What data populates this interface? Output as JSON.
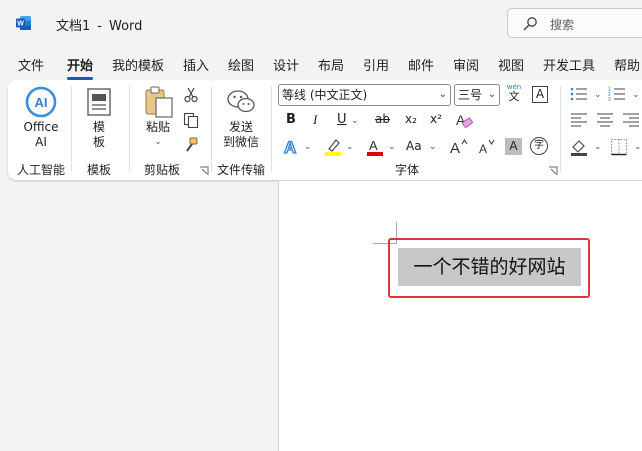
{
  "titlebar": {
    "doc_name": "文档1",
    "separator": "-",
    "app_name": "Word",
    "search_placeholder": "搜索"
  },
  "tabs": [
    {
      "label": "文件"
    },
    {
      "label": "开始",
      "active": true
    },
    {
      "label": "我的模板"
    },
    {
      "label": "插入"
    },
    {
      "label": "绘图"
    },
    {
      "label": "设计"
    },
    {
      "label": "布局"
    },
    {
      "label": "引用"
    },
    {
      "label": "邮件"
    },
    {
      "label": "审阅"
    },
    {
      "label": "视图"
    },
    {
      "label": "开发工具"
    },
    {
      "label": "帮助"
    }
  ],
  "ribbon": {
    "ai": {
      "button_line1": "Office",
      "button_line2": "AI",
      "group": "人工智能"
    },
    "templates": {
      "button_line1": "模",
      "button_line2": "板",
      "group": "模板"
    },
    "clipboard": {
      "paste": "粘贴",
      "group": "剪贴板"
    },
    "transfer": {
      "button_line1": "发送",
      "button_line2": "到微信",
      "group": "文件传输"
    },
    "font": {
      "font_name": "等线 (中文正文)",
      "font_size": "三号",
      "phonetic_top": "wén",
      "phonetic_char": "文",
      "border_char": "A",
      "bold": "B",
      "italic": "I",
      "underline": "U",
      "strike": "ab",
      "subscript": "x₂",
      "superscript": "x²",
      "grow": "A^",
      "shrink": "Aˇ",
      "change_case": "Aa",
      "shading_char": "A",
      "enclose_char": "字",
      "group": "字体"
    }
  },
  "colors": {
    "accent": "#185abd",
    "highlight_yellow": "#ffff00",
    "font_red": "#e00000",
    "annotation_red": "#e0353b"
  },
  "document": {
    "selected_text": "一个不错的好网站"
  }
}
